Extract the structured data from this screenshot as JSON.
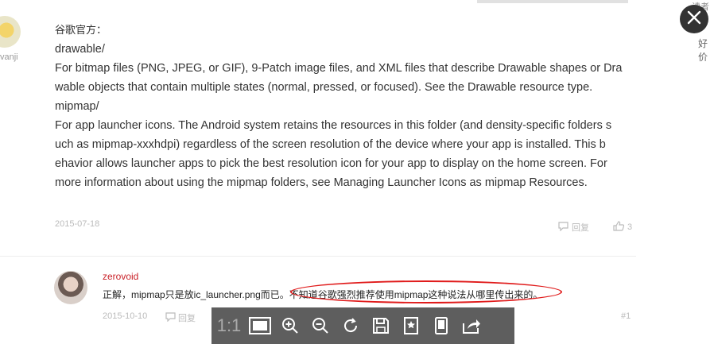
{
  "post": {
    "title": "谷歌官方：",
    "lines": [
      "drawable/",
      "For bitmap files (PNG, JPEG, or GIF), 9-Patch image files, and XML files that describe Drawable shapes or Dra",
      "wable objects that contain multiple states (normal, pressed, or focused). See the Drawable resource type.",
      "mipmap/",
      "For app launcher icons. The Android system retains the resources in this folder (and density-specific folders s",
      "uch as mipmap-xxxhdpi) regardless of the screen resolution of the device where your app is installed. This b",
      "ehavior allows launcher apps to pick the best resolution icon for your app to display on the home screen. For",
      "more information about using the mipmap folders, see Managing Launcher Icons as mipmap Resources."
    ],
    "date": "2015-07-18",
    "reply_label": "回复",
    "like_count": "3",
    "author_partial": "vanji"
  },
  "comment": {
    "name": "zerovoid",
    "text": "正解，mipmap只是放ic_launcher.png而已。不知道谷歌强烈推荐使用mipmap这种说法从哪里传出来的。",
    "date": "2015-10-10",
    "reply_label": "回复",
    "floor": "#1"
  },
  "sidebar": {
    "partial_top": "读者",
    "partial_good": "好价"
  },
  "viewer": {
    "ratio_label": "1:1",
    "icons": [
      "actual-size-icon",
      "fit-screen-icon",
      "zoom-in-icon",
      "zoom-out-icon",
      "rotate-icon",
      "save-icon",
      "bookmark-icon",
      "mobile-icon",
      "share-icon"
    ]
  },
  "colors": {
    "accent_red": "#c92027",
    "annotation_red": "#e01b1b",
    "toolbar_bg": "#505050"
  }
}
